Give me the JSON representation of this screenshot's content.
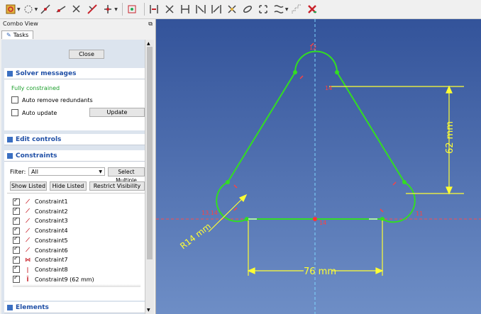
{
  "toolbar": {
    "icons": [
      "sketch-icon",
      "circle-icon",
      "constrain-coincident-icon",
      "constrain-point-on-object-icon",
      "constrain-vertical-icon",
      "constrain-horizontal-icon",
      "constrain-parallel-icon",
      "constrain-perpendicular-icon",
      "constrain-tangent-icon",
      "constrain-equal-icon",
      "constrain-symmetric-icon",
      "constrain-lock-icon",
      "constrain-block-icon",
      "constrain-distance-icon",
      "constrain-radius-icon",
      "constrain-angle-icon",
      "constrain-snell-icon",
      "grid-icon",
      "delete-constraints-icon"
    ]
  },
  "combo": {
    "title": "Combo View",
    "tab_label": "Tasks"
  },
  "task": {
    "close_label": "Close"
  },
  "solver": {
    "title": "Solver messages",
    "status": "Fully constrained",
    "status_color": "#1a9e2a",
    "auto_remove": "Auto remove redundants",
    "auto_update": "Auto update",
    "update_label": "Update"
  },
  "edit_controls": {
    "title": "Edit controls"
  },
  "constraints": {
    "title": "Constraints",
    "filter_label": "Filter:",
    "filter_value": "All",
    "select_multiple": "Select Multiple",
    "show_listed": "Show Listed",
    "hide_listed": "Hide Listed",
    "restrict_visibility": "Restrict Visibility",
    "items": [
      {
        "label": "Constraint1",
        "icon": "tangent-icon",
        "checked": true
      },
      {
        "label": "Constraint2",
        "icon": "tangent-icon",
        "checked": true
      },
      {
        "label": "Constraint3",
        "icon": "tangent-icon",
        "checked": true
      },
      {
        "label": "Constraint4",
        "icon": "tangent-icon",
        "checked": true
      },
      {
        "label": "Constraint5",
        "icon": "tangent-icon",
        "checked": true
      },
      {
        "label": "Constraint6",
        "icon": "tangent-icon",
        "checked": true
      },
      {
        "label": "Constraint7",
        "icon": "symmetric-icon",
        "checked": true
      },
      {
        "label": "Constraint8",
        "icon": "vertical-icon",
        "checked": true
      },
      {
        "label": "Constraint9 (62 mm)",
        "icon": "vertical-distance-icon",
        "checked": true
      }
    ]
  },
  "elements": {
    "title": "Elements"
  },
  "view": {
    "dim_vertical": "62 mm",
    "dim_horizontal": "76 mm",
    "dim_radius": "R14 mm",
    "label_top": "12",
    "label_center": "14",
    "label_left": "13,14",
    "label_right": "11",
    "line_color": "#33dd22",
    "dim_color": "#ffff33",
    "axis_color": "#ff3333"
  }
}
